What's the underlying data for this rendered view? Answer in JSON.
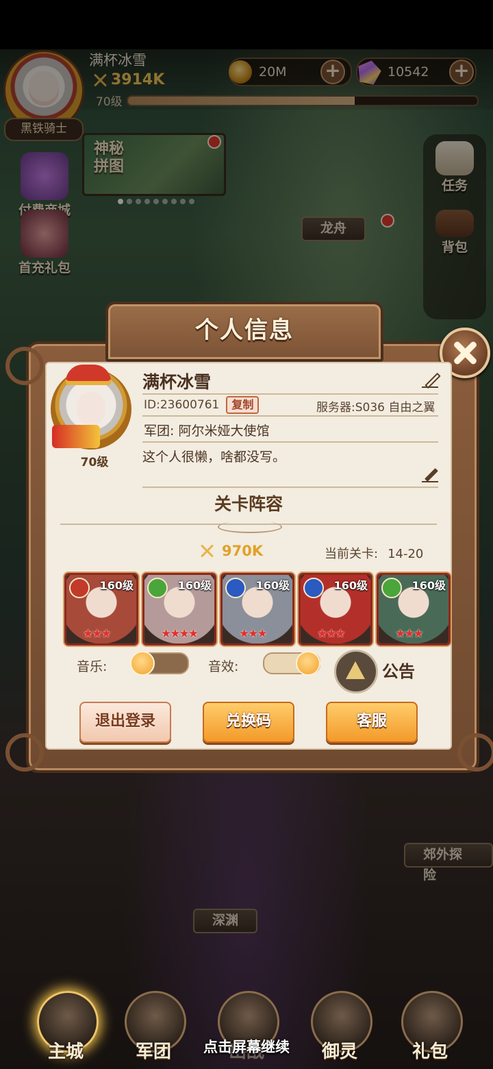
{
  "header": {
    "player_name": "满杯冰雪",
    "combat_power": "3914K",
    "level": "70级",
    "xp_fraction": 0.65,
    "title_badge": "黑铁骑士",
    "gold": "20M",
    "gems": "10542"
  },
  "background": {
    "puzzle_banner": "神秘\n拼图",
    "left_buttons": [
      "付费商城",
      "首充礼包"
    ],
    "right_buttons": [
      "任务",
      "背包"
    ],
    "map_labels": [
      "龙舟",
      "深渊",
      "郊外探险"
    ]
  },
  "dialog": {
    "title": "个人信息",
    "profile": {
      "name": "满杯冰雪",
      "level": "70级",
      "id_label": "ID:23600761",
      "copy_label": "复制",
      "server": "服务器:S036 自由之翼",
      "legion": "军团: 阿尔米娅大使馆",
      "signature": "这个人很懒，啥都没写。"
    },
    "lineup_title": "关卡阵容",
    "power": "970K",
    "stage_label": "当前关卡:",
    "stage_value": "14-20",
    "heroes": [
      {
        "level": "160级",
        "element": "fire",
        "stars": "★★★",
        "color": "#a84a3a"
      },
      {
        "level": "160级",
        "element": "wind",
        "stars": "★★★★",
        "color": "#b59a9a"
      },
      {
        "level": "160级",
        "element": "water",
        "stars": "★★★",
        "color": "#8a8f9a"
      },
      {
        "level": "160级",
        "element": "water",
        "stars": "★★★",
        "color": "#b3302a"
      },
      {
        "level": "160级",
        "element": "wind",
        "stars": "★★★",
        "color": "#4a6a58"
      }
    ],
    "music_label": "音乐:",
    "music_on": false,
    "sfx_label": "音效:",
    "sfx_on": true,
    "announcement_label": "公告",
    "buttons": {
      "logout": "退出登录",
      "redeem": "兑换码",
      "support": "客服"
    }
  },
  "bottom_nav": [
    "主城",
    "军团",
    "出战",
    "御灵",
    "礼包"
  ],
  "continue_hint": "点击屏幕继续",
  "colors": {
    "panel": "#f3ece0",
    "frame": "#7b5235",
    "accent_orange": "#f39a2a"
  }
}
